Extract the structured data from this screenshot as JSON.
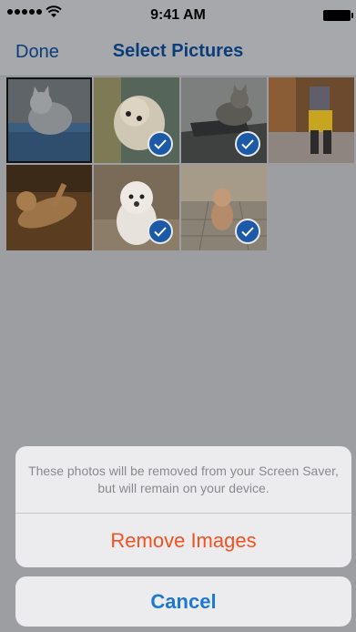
{
  "status_bar": {
    "time": "9:41 AM",
    "signal_icon": "signal-dots-icon",
    "wifi_icon": "wifi-icon",
    "battery_icon": "battery-icon"
  },
  "nav": {
    "done_label": "Done",
    "title": "Select Pictures",
    "accent_color": "#0b3d7a"
  },
  "photos": [
    {
      "subject": "gray tabby cat on blue pillow",
      "selected": false,
      "highlighted": true
    },
    {
      "subject": "curly white dog on sofa",
      "selected": true,
      "highlighted": false
    },
    {
      "subject": "tabby cat lying on laptop",
      "selected": true,
      "highlighted": false
    },
    {
      "subject": "child in yellow pants in kitchen",
      "selected": false,
      "highlighted": false
    },
    {
      "subject": "cat stretching on floor",
      "selected": false,
      "highlighted": false
    },
    {
      "subject": "white fluffy dog",
      "selected": true,
      "highlighted": false
    },
    {
      "subject": "small dog standing on tile floor",
      "selected": true,
      "highlighted": false
    }
  ],
  "action_sheet": {
    "message": "These photos will be removed from your Screen Saver, but will remain on your device.",
    "remove_label": "Remove Images",
    "cancel_label": "Cancel",
    "destructive_color": "#f3511f",
    "cancel_color": "#1e78d0"
  }
}
